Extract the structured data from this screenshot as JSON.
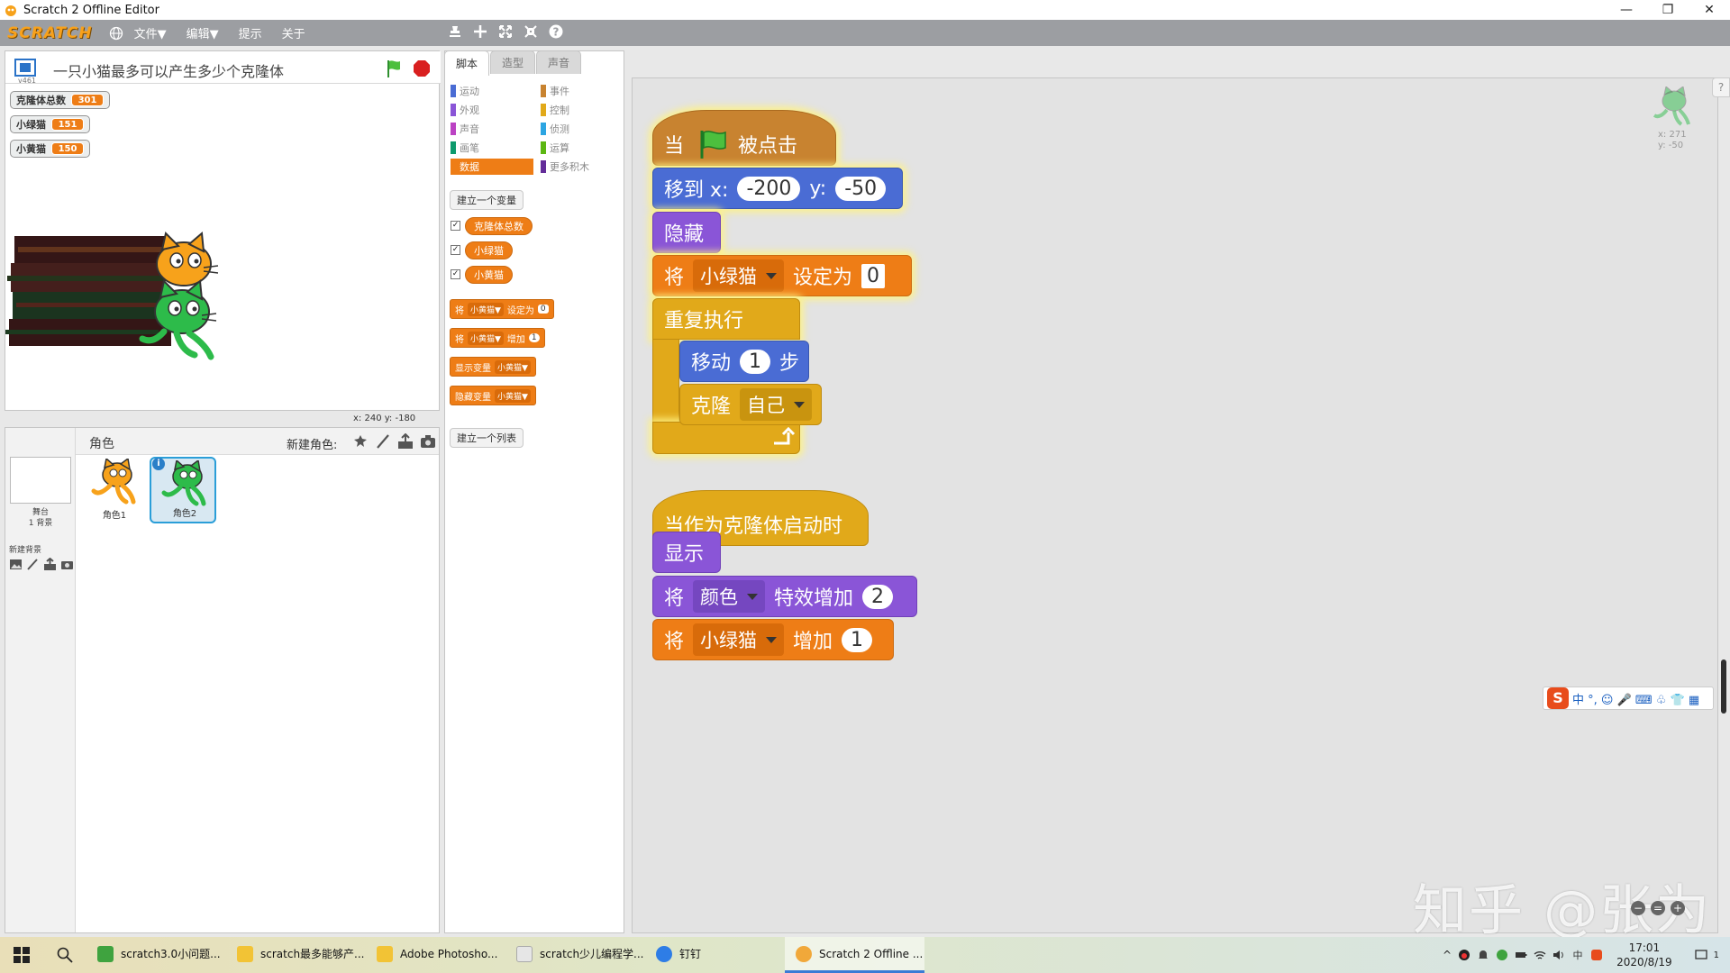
{
  "window": {
    "title": "Scratch 2 Offline Editor",
    "minimize": "—",
    "maximize": "❐",
    "close": "✕"
  },
  "menu": {
    "logo": "SCRATCH",
    "file": "文件▼",
    "edit": "编辑▼",
    "tips": "提示",
    "about": "关于"
  },
  "stage": {
    "version": "v461",
    "project_title": "一只小猫最多可以产生多少个克隆体",
    "coords": "x: 240  y: -180",
    "monitors": [
      {
        "label": "克隆体总数",
        "value": "301"
      },
      {
        "label": "小绿猫",
        "value": "151"
      },
      {
        "label": "小黄猫",
        "value": "150"
      }
    ]
  },
  "sprites": {
    "header": "角色",
    "new_sprite": "新建角色:",
    "stage_label": "舞台",
    "stage_backdrops": "1 背景",
    "new_backdrop": "新建背景",
    "items": [
      {
        "name": "角色1"
      },
      {
        "name": "角色2"
      }
    ],
    "info_icon": "i"
  },
  "tabs": [
    "脚本",
    "造型",
    "声音"
  ],
  "categories": {
    "left": [
      {
        "label": "运动",
        "color": "#4a6cd4"
      },
      {
        "label": "外观",
        "color": "#8a55d7"
      },
      {
        "label": "声音",
        "color": "#bb42c3"
      },
      {
        "label": "画笔",
        "color": "#0e9a6c"
      },
      {
        "label": "数据",
        "color": "#ee7d16"
      }
    ],
    "right": [
      {
        "label": "事件",
        "color": "#c88330"
      },
      {
        "label": "控制",
        "color": "#e1a91a"
      },
      {
        "label": "侦测",
        "color": "#2ca5e2"
      },
      {
        "label": "运算",
        "color": "#5cb712"
      },
      {
        "label": "更多积木",
        "color": "#632d99"
      }
    ]
  },
  "palette": {
    "make_variable": "建立一个变量",
    "make_list": "建立一个列表",
    "variables": [
      "克隆体总数",
      "小绿猫",
      "小黄猫"
    ],
    "check": "✓",
    "blocks": {
      "set_word": "将",
      "set_var": "小黄猫▼",
      "set_to": "设定为",
      "set_value": "0",
      "change_word": "将",
      "change_var": "小黄猫▼",
      "change_by": "增加",
      "change_value": "1",
      "show_var": "显示变量",
      "show_var_dd": "小黄猫▼",
      "hide_var": "隐藏变量",
      "hide_var_dd": "小黄猫▼"
    }
  },
  "script1": {
    "when": "当",
    "clicked": "被点击",
    "goto": "移到 x:",
    "x": "-200",
    "y_label": "y:",
    "y": "-50",
    "hide": "隐藏",
    "set_word": "将",
    "set_var": "小绿猫",
    "set_to": "设定为",
    "set_value": "0",
    "forever": "重复执行",
    "move": "移动",
    "steps": "1",
    "step_word": "步",
    "clone": "克隆",
    "clone_target": "自己"
  },
  "script2": {
    "hat": "当作为克隆体启动时",
    "show": "显示",
    "set_word": "将",
    "effect": "颜色",
    "effect_change": "特效增加",
    "effect_value": "2",
    "change_word": "将",
    "change_var": "小绿猫",
    "change_by": "增加",
    "change_value": "1"
  },
  "sprite_corner": {
    "x": "x: 271",
    "y": "y: -50"
  },
  "help": "?",
  "watermark": "知乎 @张为",
  "ime": {
    "logo": "S",
    "text": "中 °, ☺ 🎤 ⌨ ♧ 👕 ▦"
  },
  "taskbar": {
    "tasks": [
      {
        "label": "scratch3.0小问题...",
        "color": "#3fa33f"
      },
      {
        "label": "scratch最多能够产...",
        "color": "#f2c335"
      },
      {
        "label": "Adobe Photosho...",
        "color": "#f2c335"
      },
      {
        "label": "scratch少儿编程学...",
        "color": "#e6e6e6"
      },
      {
        "label": "钉钉",
        "color": "#2e7de6"
      },
      {
        "label": "Scratch 2 Offline ...",
        "color": "#f1a83a"
      }
    ],
    "time": "17:01",
    "date": "2020/8/19",
    "tray_chevron": "^",
    "notif": "1"
  },
  "zoom": {
    "minus": "−",
    "eq": "=",
    "plus": "+"
  }
}
